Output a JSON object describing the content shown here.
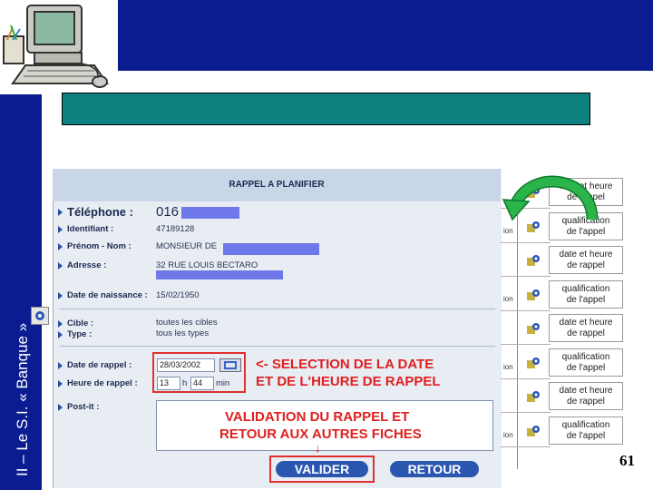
{
  "slide": {
    "side_title": "II – Le S.I. « Banque »",
    "page_number": "61",
    "title_box_text": ""
  },
  "form": {
    "header": "RAPPEL A PLANIFIER",
    "telephone": {
      "label": "Téléphone :",
      "value": "016"
    },
    "identifiant": {
      "label": "Identifiant :",
      "value": "47189128"
    },
    "nom": {
      "label": "Prénom - Nom :",
      "value": "MONSIEUR DE"
    },
    "adresse": {
      "label": "Adresse :",
      "value": "32 RUE LOUIS BECTARO"
    },
    "naissance": {
      "label": "Date de naissance :",
      "value": "15/02/1950"
    },
    "cible": {
      "label": "Cible :",
      "value": "toutes les cibles"
    },
    "type": {
      "label": "Type :",
      "value": "tous les types"
    },
    "date_rappel": {
      "label": "Date de rappel :",
      "value": "28/03/2002"
    },
    "heure_rappel": {
      "label": "Heure de rappel :",
      "hours": "13",
      "h": "h",
      "minutes": "44",
      "min": "min"
    },
    "postit": {
      "label": "Post-it :"
    },
    "annotation_date": {
      "line1": "<- SELECTION DE LA DATE",
      "line2": "ET DE L'HEURE DE RAPPEL"
    },
    "annotation_validation": {
      "line1": "VALIDATION DU RAPPEL ET",
      "line2": "RETOUR AUX AUTRES FICHES",
      "arrow": "↓"
    },
    "buttons": {
      "valider": "VALIDER",
      "retour": "RETOUR"
    }
  },
  "right_list": {
    "items": [
      {
        "line1": "date et heure",
        "line2": "de rappel"
      },
      {
        "line1": "qualification",
        "line2": "de l'appel"
      },
      {
        "line1": "date et heure",
        "line2": "de rappel"
      },
      {
        "line1": "qualification",
        "line2": "de l'appel"
      },
      {
        "line1": "date et heure",
        "line2": "de rappel"
      },
      {
        "line1": "qualification",
        "line2": "de l'appel"
      },
      {
        "line1": "date et heure",
        "line2": "de rappel"
      },
      {
        "line1": "qualification",
        "line2": "de l'appel"
      }
    ],
    "side_text": "ion"
  },
  "colors": {
    "band": "#0a1c8f",
    "title_box": "#0d8080",
    "arrow": "#1c9a3c",
    "annotation": "#e02020"
  },
  "icons": [
    "computer-illustration-icon",
    "curved-arrow-icon",
    "calendar-icon",
    "gear-icon"
  ]
}
